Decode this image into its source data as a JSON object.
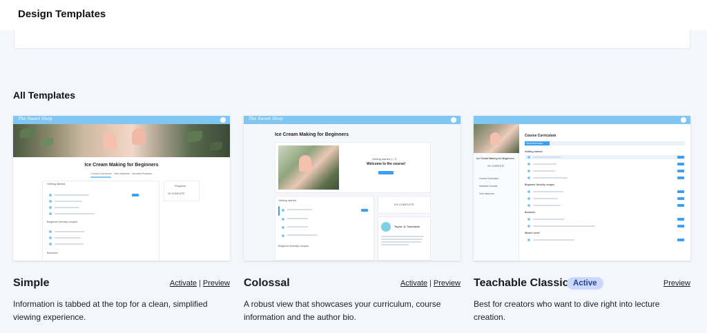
{
  "header": {
    "title": "Design Templates"
  },
  "section": {
    "title": "All Templates"
  },
  "templates": [
    {
      "name": "Simple",
      "activate_label": "Activate",
      "separator": "|",
      "preview_label": "Preview",
      "description": "Information is tabbed at the top for a clean, simplified viewing experience.",
      "thumb": {
        "brand": "The Sweet Shop",
        "course_title": "Ice Cream Making for Beginners",
        "tabs": [
          "Course Curriculum",
          "Your Instructor",
          "Included Products"
        ],
        "progress_label": "Progress",
        "progress_value": "0% COMPLETE",
        "section_1": "Getting started",
        "section_2": "Beginner friendly recipes",
        "section_3": "Bonuses"
      }
    },
    {
      "name": "Colossal",
      "activate_label": "Activate",
      "separator": "|",
      "preview_label": "Preview",
      "description": "A robust view that showcases your curriculum, course information and the author bio.",
      "thumb": {
        "brand": "The Sweet Shop",
        "course_title": "Ice Cream Making for Beginners",
        "welcome_kicker": "Getting started 1 / 3",
        "welcome": "Welcome to the course!",
        "progress_value": "0% COMPLETE",
        "author": "Taylor @ Teachable",
        "section_1": "Getting started",
        "section_2": "Beginner friendly recipes"
      }
    },
    {
      "name": "Teachable Classic",
      "status_badge": "Active",
      "preview_label": "Preview",
      "description": "Best for creators who want to dive right into lecture creation.",
      "thumb": {
        "course_title": "Ice Cream Making for Beginners",
        "progress_value": "0% COMPLETE",
        "curriculum_title": "Course Curriculum",
        "start_button": "Start next lecture",
        "nav": [
          "Course Curriculum",
          "Included Courses",
          "Your Instructor"
        ],
        "section_1": "Getting started",
        "section_2": "Beginner friendly recipes",
        "section_3": "Bonuses",
        "section_4": "What's next?"
      }
    }
  ],
  "colors": {
    "accent": "#7fc6f2",
    "button": "#3d9ff3",
    "badge_bg": "#c9d8fb"
  }
}
